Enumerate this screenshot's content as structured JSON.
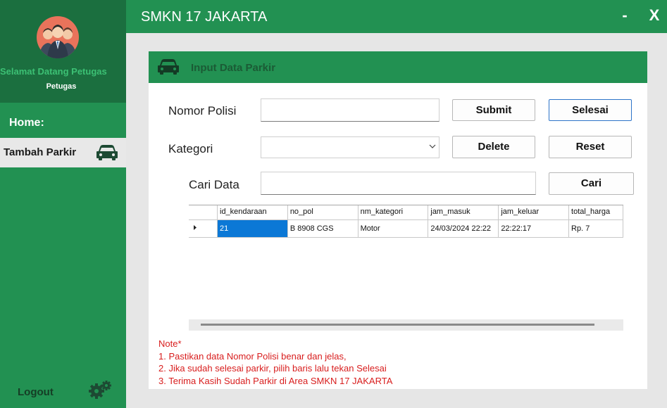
{
  "sidebar": {
    "welcome": "Selamat Datang Petugas",
    "role": "Petugas",
    "home": "Home:",
    "active_item": "Tambah Parkir",
    "logout": "Logout",
    "icons": {
      "avatar": "users-group-icon",
      "car": "car-icon",
      "settings": "gears-icon"
    }
  },
  "titlebar": {
    "title": "SMKN 17 JAKARTA",
    "minimize": "-",
    "close": "X"
  },
  "panel": {
    "header": "Input Data Parkir",
    "nomor_label": "Nomor Polisi",
    "nomor_value": "",
    "kategori_label": "Kategori",
    "kategori_value": "",
    "cari_label": "Cari Data",
    "cari_value": "",
    "buttons": {
      "submit": "Submit",
      "selesai": "Selesai",
      "delete": "Delete",
      "reset": "Reset",
      "cari": "Cari"
    }
  },
  "grid": {
    "columns": [
      "id_kendaraan",
      "no_pol",
      "nm_kategori",
      "jam_masuk",
      "jam_keluar",
      "total_harga"
    ],
    "rows": [
      [
        "21",
        "B 8908 CGS",
        "Motor",
        "24/03/2024 22:22",
        "22:22:17",
        "Rp. 7"
      ]
    ]
  },
  "notes": [
    "Note*",
    "1. Pastikan data Nomor Polisi benar dan jelas,",
    "2. Jika sudah selesai parkir, pilih baris lalu tekan Selesai",
    "3. Terima Kasih Sudah Parkir di Area SMKN 17 JAKARTA"
  ],
  "colors": {
    "primary_green": "#229152",
    "dark_green": "#1b6f3f",
    "note_red": "#d81d1d",
    "selection_blue": "#0b78d6"
  }
}
